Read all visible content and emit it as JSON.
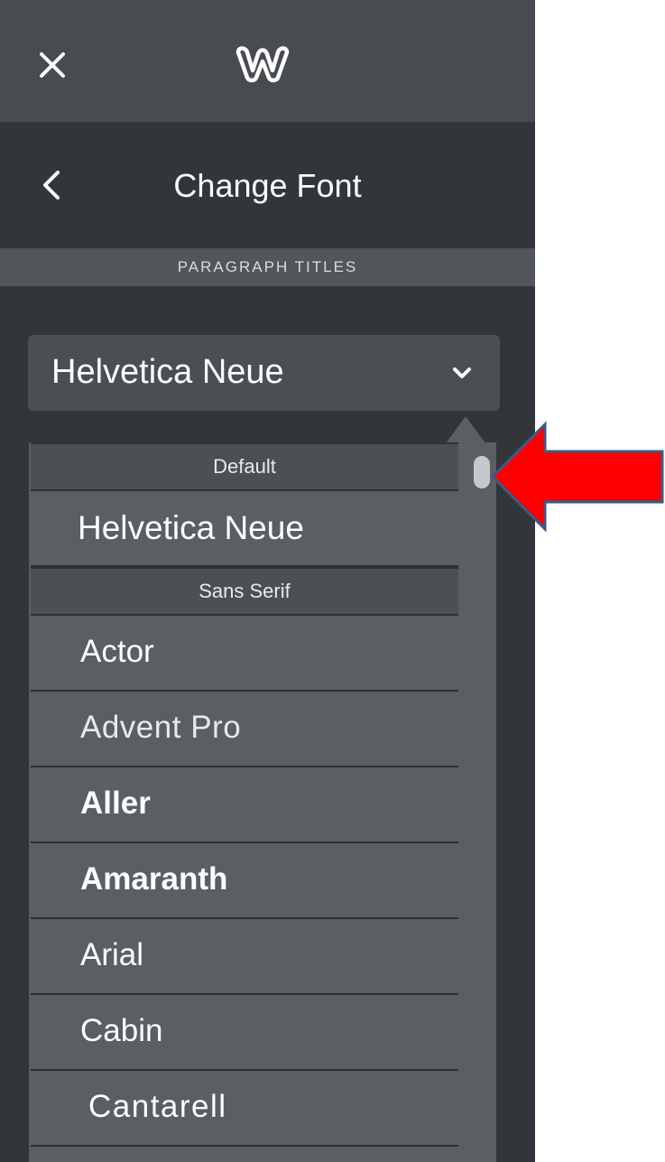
{
  "topbar": {
    "close_icon": "close-icon",
    "logo_icon": "weebly-logo-icon"
  },
  "header": {
    "back_icon": "chevron-left-icon",
    "title": "Change Font"
  },
  "section": {
    "label": "PARAGRAPH TITLES"
  },
  "select": {
    "value": "Helvetica Neue",
    "chevron_icon": "chevron-down-icon"
  },
  "dropdown": {
    "groups": [
      {
        "label": "Default"
      },
      {
        "label": "Sans Serif"
      }
    ],
    "default_option": "Helvetica Neue",
    "options": [
      {
        "label": "Actor"
      },
      {
        "label": "Advent Pro"
      },
      {
        "label": "Aller"
      },
      {
        "label": "Amaranth"
      },
      {
        "label": "Arial"
      },
      {
        "label": "Cabin"
      },
      {
        "label": "Cantarell"
      }
    ]
  },
  "annotation": {
    "arrow_color": "#ff0000",
    "arrow_outline": "#3a5a8c"
  },
  "colors": {
    "panel_bg": "#32363a",
    "topbar_bg": "#484c50",
    "dropdown_bg": "#5a5f64",
    "accent_white": "#ffffff"
  }
}
